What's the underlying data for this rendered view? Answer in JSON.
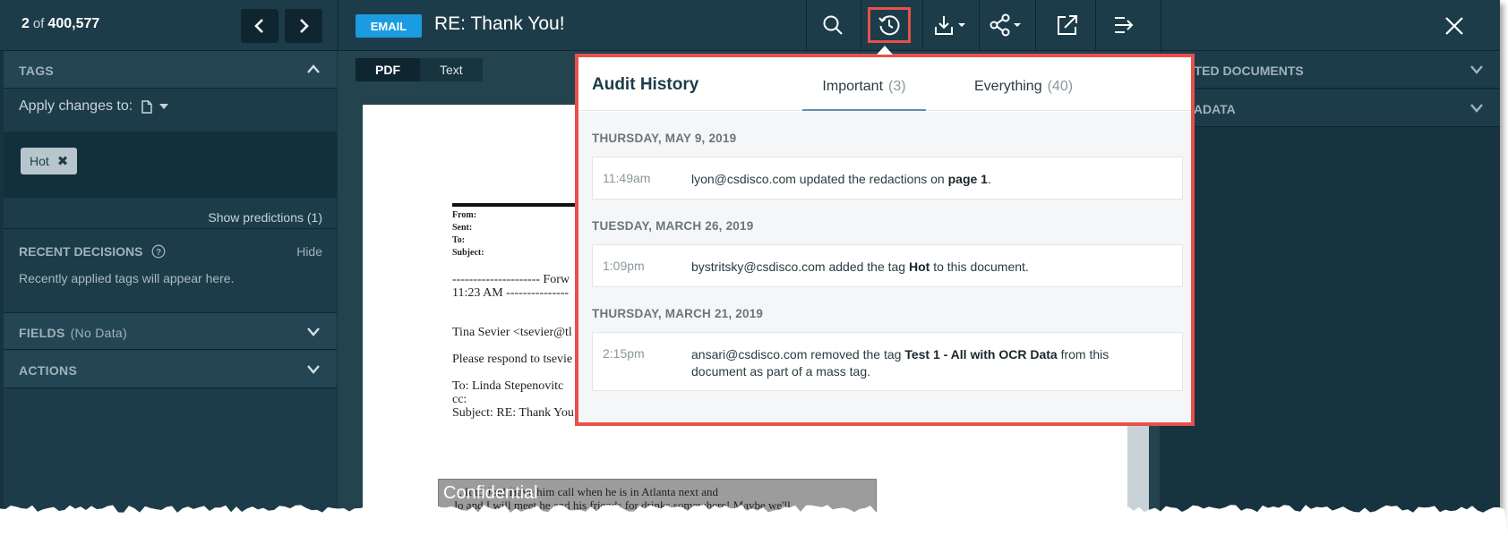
{
  "nav": {
    "current": "2",
    "of_label": "of",
    "total": "400,577"
  },
  "header": {
    "badge": "EMAIL",
    "title": "RE: Thank You!"
  },
  "left_panel": {
    "tags_header": "TAGS",
    "apply_label": "Apply changes to:",
    "tag_chip": "Hot",
    "show_predictions": "Show predictions (1)",
    "recent_header": "RECENT DECISIONS",
    "recent_hide": "Hide",
    "recent_empty": "Recently applied tags will appear here.",
    "fields_header": "FIELDS",
    "fields_sub": "(No Data)",
    "actions_header": "ACTIONS"
  },
  "viewer": {
    "tabs": [
      "PDF",
      "Text"
    ],
    "active_tab": "PDF",
    "fields": [
      "From:",
      "Sent:",
      "To:",
      "Subject:"
    ],
    "lines": [
      "--------------------- Forw",
      "11:23 AM ---------------",
      "Tina Sevier <tsevier@tl",
      "Please respond to tsevie",
      "To:   Linda Stepenovitc",
      "cc:",
      "Subject:  RE: Thank You!"
    ],
    "redaction_label": "Confidential",
    "redacted_line1": "... It to Joe!  Have him call when he is in Atlanta next and",
    "redacted_line2": "Jo and I will meet he and his friends for drinks somewhere!  Maybe we'll"
  },
  "right_panel": {
    "related_header": "LATED DOCUMENTS",
    "metadata_header": "ETADATA"
  },
  "audit": {
    "title": "Audit History",
    "tabs": [
      {
        "label": "Important",
        "count": "(3)"
      },
      {
        "label": "Everything",
        "count": "(40)"
      }
    ],
    "groups": [
      {
        "date": "THURSDAY, MAY 9, 2019",
        "time": "11:49am",
        "parts": [
          "lyon@csdisco.com updated the redactions on ",
          "page 1",
          "."
        ]
      },
      {
        "date": "TUESDAY, MARCH 26, 2019",
        "time": "1:09pm",
        "parts": [
          "bystritsky@csdisco.com added the tag ",
          "Hot",
          " to this document."
        ]
      },
      {
        "date": "THURSDAY, MARCH 21, 2019",
        "time": "2:15pm",
        "parts": [
          "ansari@csdisco.com removed the tag ",
          "Test 1 - All with OCR Data",
          " from this document as part of a mass tag."
        ]
      }
    ]
  },
  "icons": {
    "prev": "chevron-left-icon",
    "next": "chevron-right-icon",
    "search": "search-icon",
    "history": "history-icon",
    "download": "download-icon",
    "share": "share-icon",
    "open_external": "open-external-icon",
    "collapse": "collapse-arrow-icon",
    "close": "close-icon"
  },
  "colors": {
    "accent_blue": "#1b9ce0",
    "highlight_red": "#e8504a",
    "panel_dark": "#1d3c4a"
  }
}
